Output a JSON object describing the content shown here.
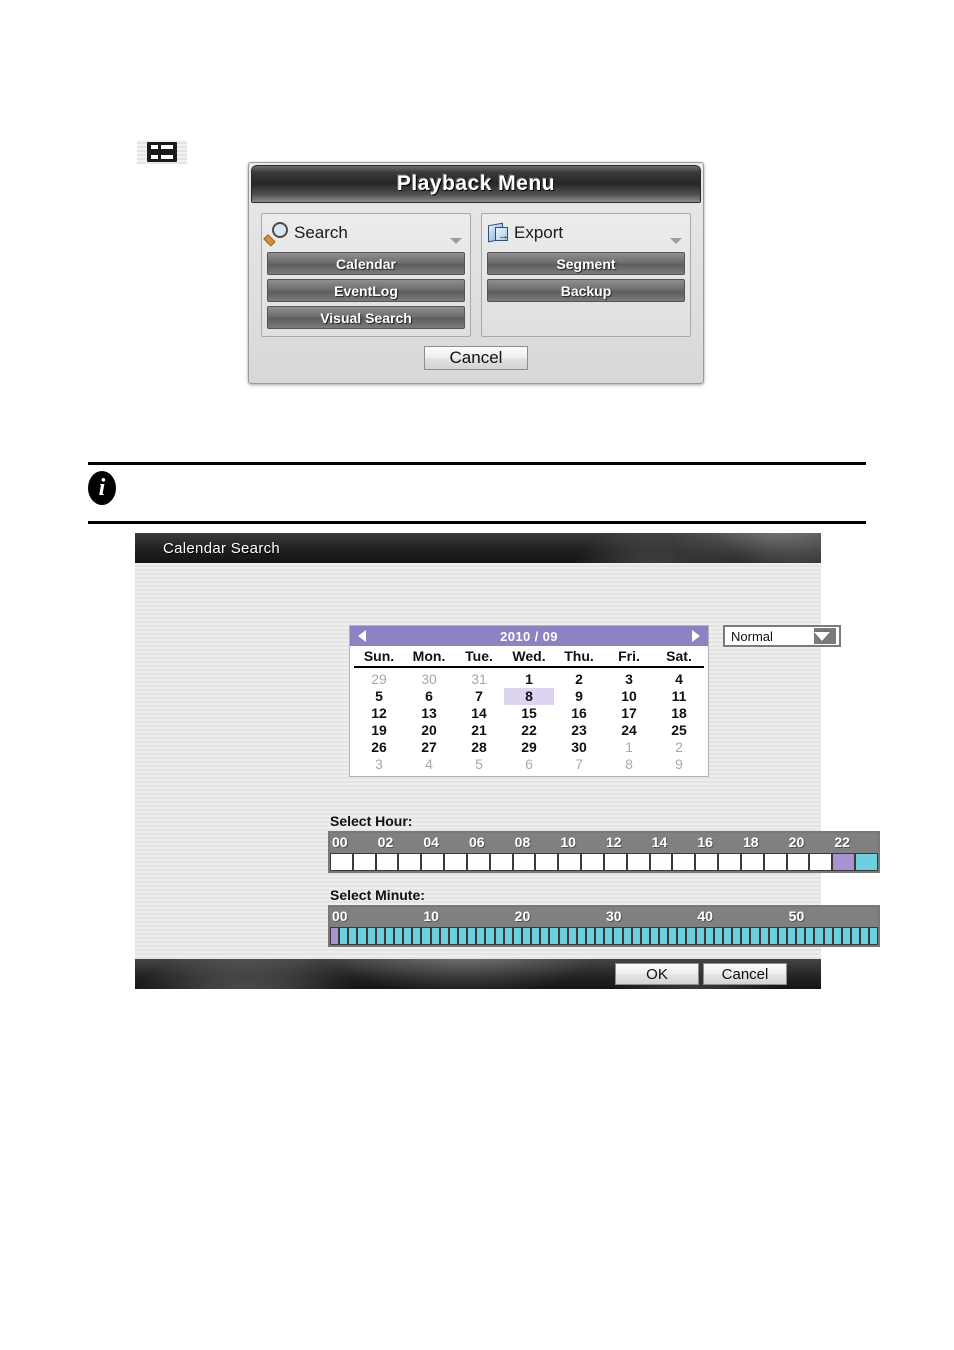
{
  "page": {
    "menu_icon": "list-menu-icon"
  },
  "playback_menu": {
    "title": "Playback Menu",
    "columns": [
      {
        "icon": "search-icon",
        "label": "Search",
        "buttons": [
          "Calendar",
          "EventLog",
          "Visual Search"
        ]
      },
      {
        "icon": "export-icon",
        "label": "Export",
        "buttons": [
          "Segment",
          "Backup"
        ]
      }
    ],
    "cancel_label": "Cancel"
  },
  "info_note": {
    "icon": "info-icon",
    "glyph": "i"
  },
  "calendar_search": {
    "title": "Calendar Search",
    "calendar": {
      "prev_icon": "arrow-left-icon",
      "next_icon": "arrow-right-icon",
      "month_label": "2010 / 09",
      "weekdays": [
        "Sun.",
        "Mon.",
        "Tue.",
        "Wed.",
        "Thu.",
        "Fri.",
        "Sat."
      ],
      "selected_day": 8,
      "weeks": [
        [
          {
            "d": "29",
            "muted": true
          },
          {
            "d": "30",
            "muted": true
          },
          {
            "d": "31",
            "muted": true
          },
          {
            "d": "1",
            "muted": false
          },
          {
            "d": "2",
            "muted": false
          },
          {
            "d": "3",
            "muted": false
          },
          {
            "d": "4",
            "muted": false
          }
        ],
        [
          {
            "d": "5",
            "muted": false
          },
          {
            "d": "6",
            "muted": false
          },
          {
            "d": "7",
            "muted": false
          },
          {
            "d": "8",
            "muted": false,
            "selected": true
          },
          {
            "d": "9",
            "muted": false
          },
          {
            "d": "10",
            "muted": false
          },
          {
            "d": "11",
            "muted": false
          }
        ],
        [
          {
            "d": "12",
            "muted": false
          },
          {
            "d": "13",
            "muted": false
          },
          {
            "d": "14",
            "muted": false
          },
          {
            "d": "15",
            "muted": false
          },
          {
            "d": "16",
            "muted": false
          },
          {
            "d": "17",
            "muted": false
          },
          {
            "d": "18",
            "muted": false
          }
        ],
        [
          {
            "d": "19",
            "muted": false
          },
          {
            "d": "20",
            "muted": false
          },
          {
            "d": "21",
            "muted": false
          },
          {
            "d": "22",
            "muted": false
          },
          {
            "d": "23",
            "muted": false
          },
          {
            "d": "24",
            "muted": false
          },
          {
            "d": "25",
            "muted": false
          }
        ],
        [
          {
            "d": "26",
            "muted": false
          },
          {
            "d": "27",
            "muted": false
          },
          {
            "d": "28",
            "muted": false
          },
          {
            "d": "29",
            "muted": false
          },
          {
            "d": "30",
            "muted": false
          },
          {
            "d": "1",
            "muted": true
          },
          {
            "d": "2",
            "muted": true
          }
        ],
        [
          {
            "d": "3",
            "muted": true
          },
          {
            "d": "4",
            "muted": true
          },
          {
            "d": "5",
            "muted": true
          },
          {
            "d": "6",
            "muted": true
          },
          {
            "d": "7",
            "muted": true
          },
          {
            "d": "8",
            "muted": true
          },
          {
            "d": "9",
            "muted": true
          }
        ]
      ]
    },
    "mode_select": {
      "value": "Normal",
      "caret_icon": "chevron-down-icon"
    },
    "hour_selector": {
      "label": "Select Hour:",
      "tick_labels": [
        "00",
        "02",
        "04",
        "06",
        "08",
        "10",
        "12",
        "14",
        "16",
        "18",
        "20",
        "22"
      ],
      "cell_count": 24,
      "selected_hour": 22,
      "available_hours": [
        23
      ],
      "states": [
        "empty",
        "empty",
        "empty",
        "empty",
        "empty",
        "empty",
        "empty",
        "empty",
        "empty",
        "empty",
        "empty",
        "empty",
        "empty",
        "empty",
        "empty",
        "empty",
        "empty",
        "empty",
        "empty",
        "empty",
        "empty",
        "empty",
        "selected",
        "available"
      ]
    },
    "minute_selector": {
      "label": "Select Minute:",
      "tick_labels": [
        "00",
        "10",
        "20",
        "30",
        "40",
        "50"
      ],
      "cell_count": 60,
      "selected_minute": 0,
      "states_note": "minute 0 selected, 1-59 available"
    },
    "footer": {
      "ok_label": "OK",
      "cancel_label": "Cancel"
    }
  },
  "colors": {
    "selected": "#a793cf",
    "available": "#6ed0dc",
    "calendar_header": "#8d82c2",
    "day_selected_bg": "#ddd4f2"
  }
}
